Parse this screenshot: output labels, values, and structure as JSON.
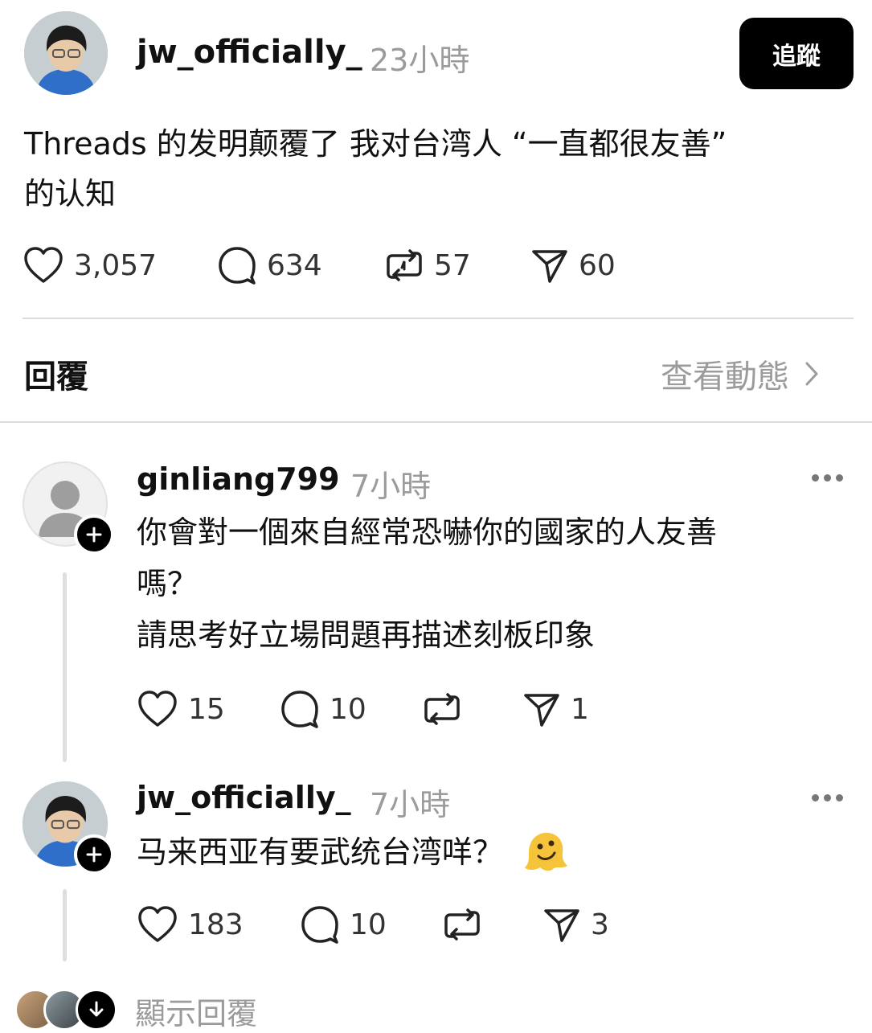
{
  "post": {
    "username": "jw_officially_",
    "time": "23小時",
    "follow_label": "追蹤",
    "text_line1": "Threads 的发明颠覆了 我对台湾人 “一直都很友善”",
    "text_line2": "的认知",
    "stats": {
      "likes": "3,057",
      "comments": "634",
      "reposts": "57",
      "shares": "60"
    }
  },
  "replies_header": {
    "title": "回覆",
    "view_activity": "查看動態"
  },
  "replies": [
    {
      "username": "ginliang799",
      "time": "7小時",
      "lines": [
        "你會對一個來自經常恐嚇你的國家的人友善",
        "嗎？",
        "請思考好立場問題再描述刻板印象"
      ],
      "stats": {
        "likes": "15",
        "comments": "10",
        "reposts": "",
        "shares": "1"
      }
    },
    {
      "username": "jw_officially_",
      "time": "7小時",
      "lines": [
        "马来西亚有要武统台湾咩？"
      ],
      "stats": {
        "likes": "183",
        "comments": "10",
        "reposts": "",
        "shares": "3"
      }
    }
  ],
  "show_replies": "顯示回覆",
  "icons": {
    "like": "heart-icon",
    "comment": "comment-bubble-icon",
    "repost": "repost-icon",
    "share": "send-icon",
    "more": "more-dots-icon",
    "follow_plus": "plus-icon",
    "chevron": "chevron-right-icon",
    "expand": "chevron-down-icon"
  }
}
